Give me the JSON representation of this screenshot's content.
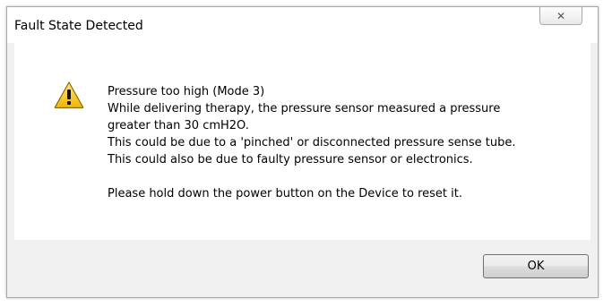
{
  "dialog": {
    "title": "Fault State Detected",
    "close_glyph": "✕",
    "icon": "warning-triangle-icon",
    "message_lines": [
      "Pressure too high (Mode 3)",
      "While delivering therapy, the pressure sensor measured a pressure",
      "greater than 30 cmH2O.",
      "This could be due to a 'pinched' or disconnected pressure sense tube.",
      "This could also be due to faulty pressure sensor or electronics."
    ],
    "instruction": "Please hold down the power button on the Device to reset it.",
    "ok_label": "OK"
  },
  "colors": {
    "warning_yellow": "#f5c400",
    "warning_outline": "#8a6a00",
    "dialog_background": "#f0f0f0",
    "content_background": "#ffffff"
  }
}
